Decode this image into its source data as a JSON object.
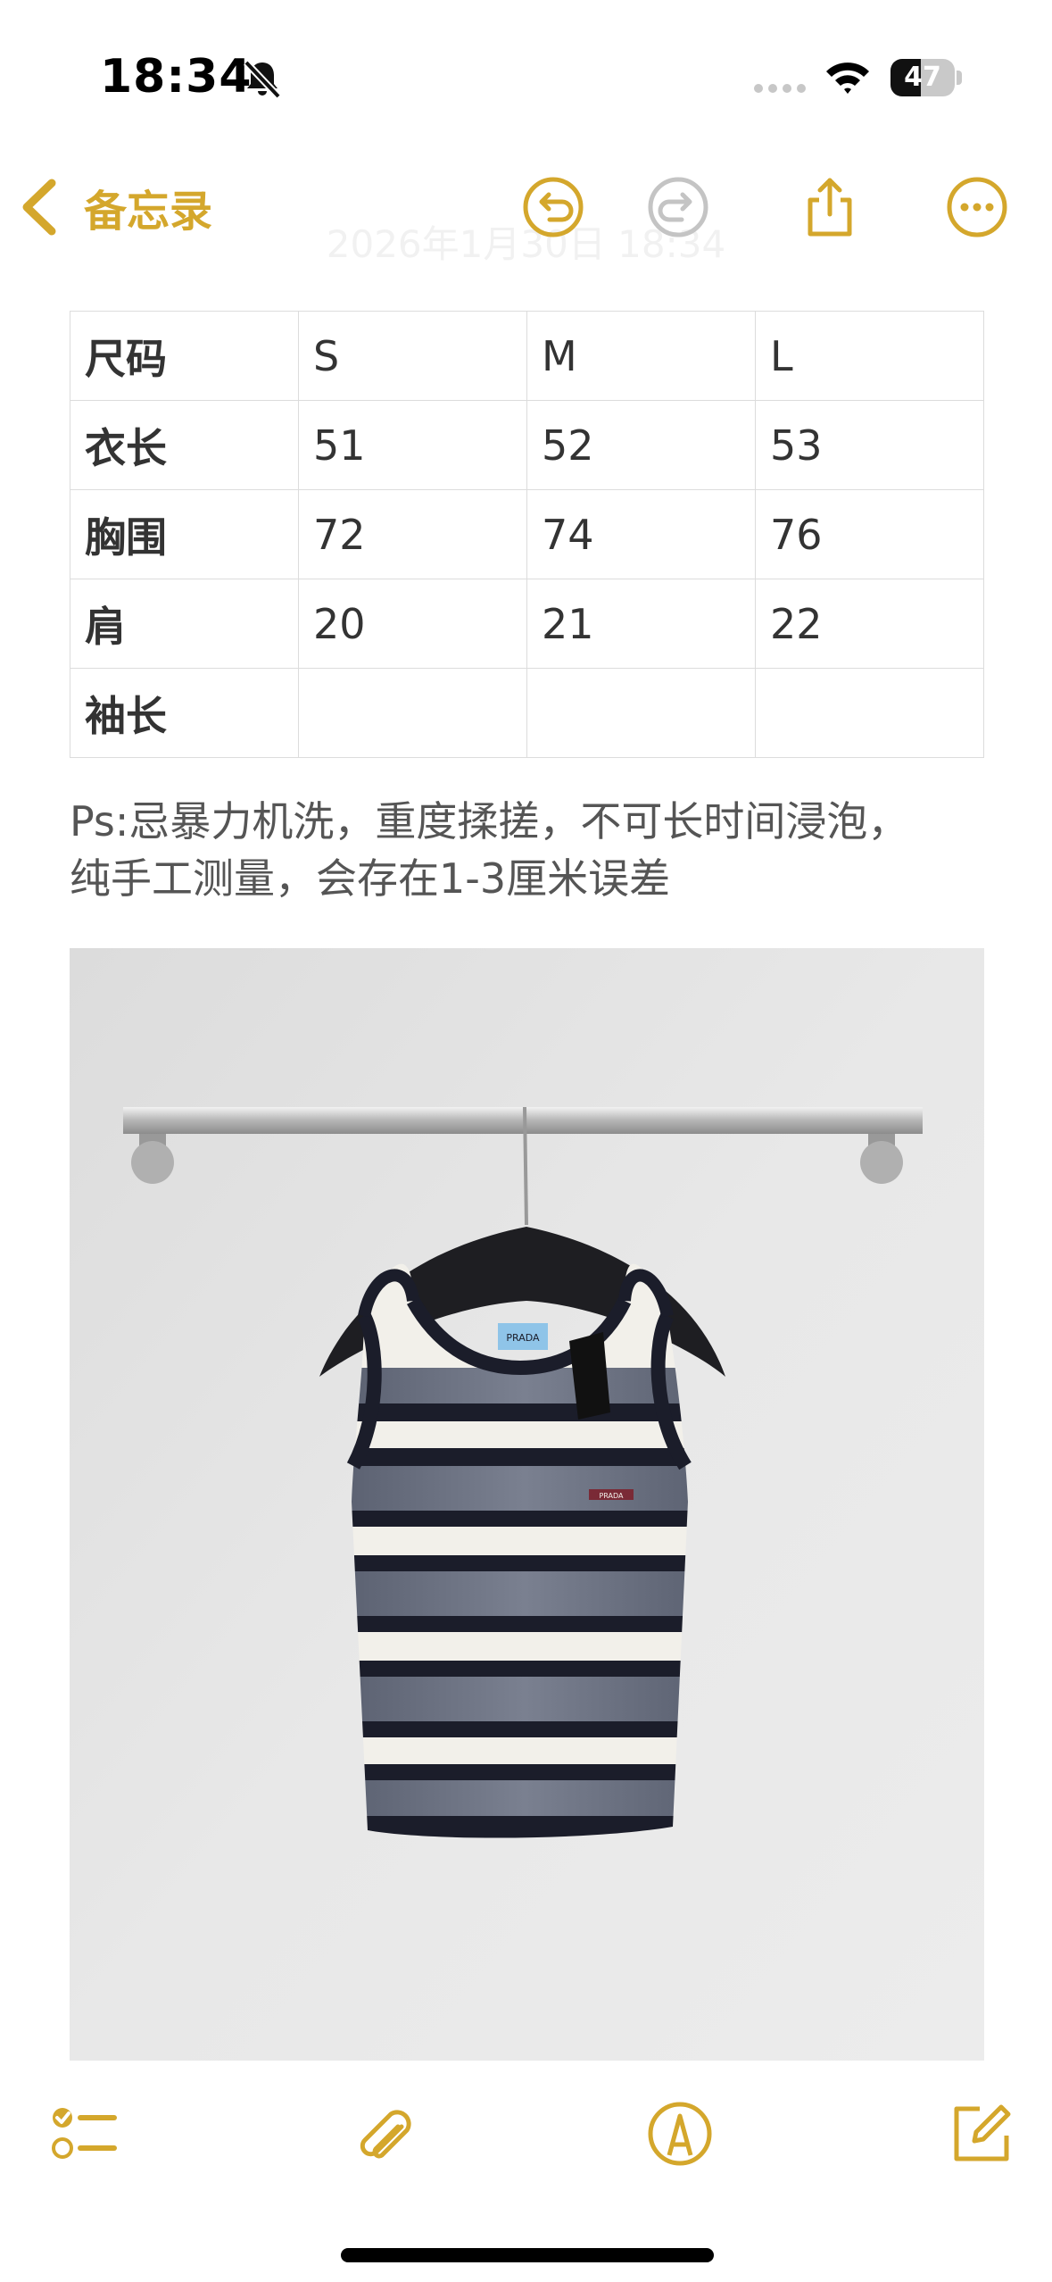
{
  "status_bar": {
    "time": "18:34",
    "battery_level": "47",
    "battery_fraction": 0.47
  },
  "nav": {
    "back_label": "备忘录",
    "faded_date": "2026年1月30日 18:34",
    "accent_color": "#d4a72c"
  },
  "size_table": {
    "rows": [
      [
        "尺码",
        "S",
        "M",
        "L"
      ],
      [
        "衣长",
        "51",
        "52",
        "53"
      ],
      [
        "胸围",
        "72",
        "74",
        "76"
      ],
      [
        "肩",
        "20",
        "21",
        "22"
      ],
      [
        "袖长",
        "",
        "",
        ""
      ]
    ]
  },
  "note": {
    "line1": "Ps:忌暴力机洗，重度揉搓，不可长时间浸泡，",
    "line2": "纯手工测量，会存在1-3厘米误差"
  },
  "photo": {
    "label_text": "PRADA",
    "tag_text": "PRADA"
  },
  "icons": {
    "undo": "undo-icon",
    "redo": "redo-icon",
    "share": "share-icon",
    "more": "more-icon",
    "checklist": "checklist-icon",
    "attachment": "paperclip-icon",
    "markup": "markup-pen-icon",
    "compose": "compose-icon"
  }
}
